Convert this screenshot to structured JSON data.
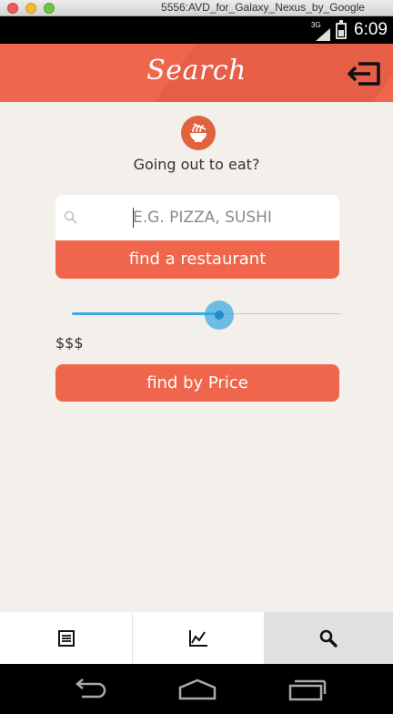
{
  "window": {
    "title": "5556:AVD_for_Galaxy_Nexus_by_Google"
  },
  "status_bar": {
    "network": "3G",
    "time": "6:09"
  },
  "header": {
    "title": "Search",
    "exit_icon": "exit-icon"
  },
  "main": {
    "icon": "noodle-bowl-icon",
    "subtitle": "Going out to eat?",
    "search": {
      "placeholder": "E.G. PIZZA, SUSHI",
      "value": ""
    },
    "find_restaurant_label": "find a restaurant",
    "price_slider": {
      "level_fraction": 0.55
    },
    "price_label": "$$$",
    "find_price_label": "find by Price"
  },
  "tabs": [
    {
      "icon": "list-icon",
      "selected": false
    },
    {
      "icon": "chart-icon",
      "selected": false
    },
    {
      "icon": "search-icon",
      "selected": true
    }
  ],
  "nav_bar": {
    "icons": [
      "back-icon",
      "home-icon",
      "recents-icon"
    ]
  },
  "colors": {
    "accent": "#ef664c",
    "slider": "#3aace0",
    "background": "#f3efea"
  }
}
